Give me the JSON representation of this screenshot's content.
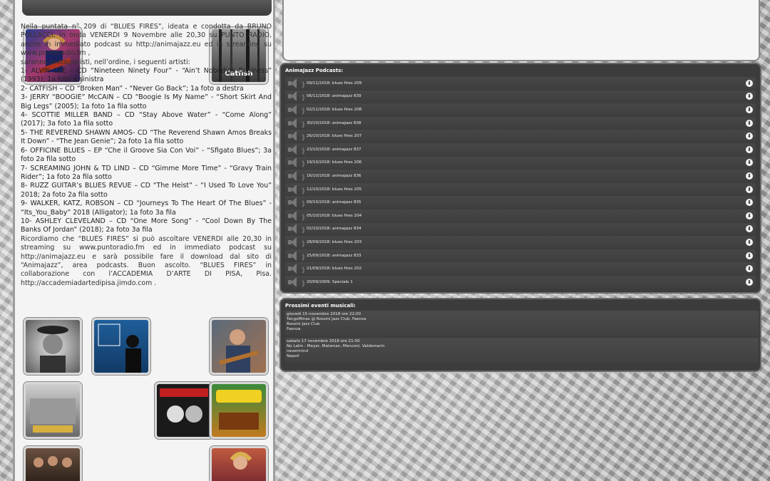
{
  "article": {
    "intro": "Nella puntata n° 209 di “BLUES FIRES”, ideata e condotta da BRUNO POLLACCI, in onda VENERDI 9 Novembre alle 20,30 su PUNTO RADIO, anche in immediato podcast su http://animajazz.eu ed in streaming su www.puntoradio.fm ,",
    "lead": "saranno protagonisti, nell’ordine, i seguenti artisti:",
    "list": [
      "1- ALVIN LEE – CD “Nineteen Ninety Four” - “Ain’t Nobody’s Business” (1993); 1a foto a sinistra",
      "2- CATFISH – CD “Broken Man” - “Never Go Back”; 1a foto a destra",
      "3- JERRY “BOOGIE” McCAIN – CD “Boogie Is My Name” - “Short Skirt And Big Legs” (2005); 1a foto 1a fila sotto",
      "4- SCOTTIE MILLER BAND – CD “Stay Above Water” - “Come Along” (2017); 3a foto 1a fila sotto",
      "5- THE REVEREND SHAWN AMOS- CD “The Reverend Shawn Amos Breaks It Down” - “The Jean Genie”; 2a foto 1a fila sotto",
      "6- OFFICINE BLUES – EP “Che il Groove Sia Con Voi” - “Sfigato Blues”; 3a foto 2a fila sotto",
      "7- SCREAMING JOHN & TD LIND – CD “Gimme More Time” - “Gravy Train Rider”; 1a foto 2a fila sotto",
      "8- RUZZ GUITAR’s BLUES REVUE – CD “The Heist” - “I Used To Love You” 2018; 2a foto 2a fila sotto",
      "9- WALKER, KATZ, ROBSON – CD “Journeys To The Heart Of The Blues” - “Its_You_Baby” 2018 (Alligator); 1a foto 3a fila",
      "10- ASHLEY CLEVELAND – CD “One More Song” - “Cool Down By The Banks Of Jordan” (2018); 2a foto 3a fila"
    ],
    "outro": "Ricordiamo che “BLUES FIRES” si può ascoltare VENERDI alle 20,30 in streaming su www.puntoradio.fm ed in immediato podcast su http://animajazz.eu e sarà possibile fare il download dal sito di “Animajazz”, area podcasts. Buon ascolto. “BLUES FIRES” in collaborazione con l’ACCADEMIA D’ARTE DI PISA, Pisa. http://accademiadartedipisa.jimdo.com .",
    "catfish_caption": "Catfish"
  },
  "podcasts": {
    "title": "AnimaJazz Podcasts:",
    "items": [
      "09/11/2018: blues fires 209",
      "06/11/2018: animajazz 839",
      "02/11/2018: blues fires 208",
      "30/10/2018: animajazz 838",
      "26/10/2018: blues fires 207",
      "23/10/2018: animajazz 837",
      "19/10/2018: blues fires 206",
      "16/10/2018: animajazz 836",
      "12/10/2018: blues fires 205",
      "09/10/2018: animajazz 835",
      "05/10/2018: blues fires 204",
      "02/10/2018: animajazz 834",
      "28/09/2018: blues fires 203",
      "25/09/2018: animajazz 833",
      "21/09/2018: blues fires 202",
      "20/09/2009: Speciale 1"
    ]
  },
  "events": {
    "title": "Prossimi eventi musicali:",
    "items": [
      {
        "lines": [
          "giovedì 15 novembre 2018 ore 22:00",
          "TangoMinas @ Rossini Jazz Club, Faenza",
          "Rossini Jazz Club",
          "Faenza"
        ]
      },
      {
        "lines": [
          "sabato 17 novembre 2018 ore 21:00",
          "No Latin - Meyer, Malaman, Menconi, Valdemarin",
          "nevermind",
          "Napoli"
        ]
      }
    ]
  },
  "colors": {
    "panel": "#3c3c3c",
    "accent": "#f2f2f2"
  },
  "icons": {
    "speaker": "speaker-icon",
    "download": "download-icon"
  }
}
